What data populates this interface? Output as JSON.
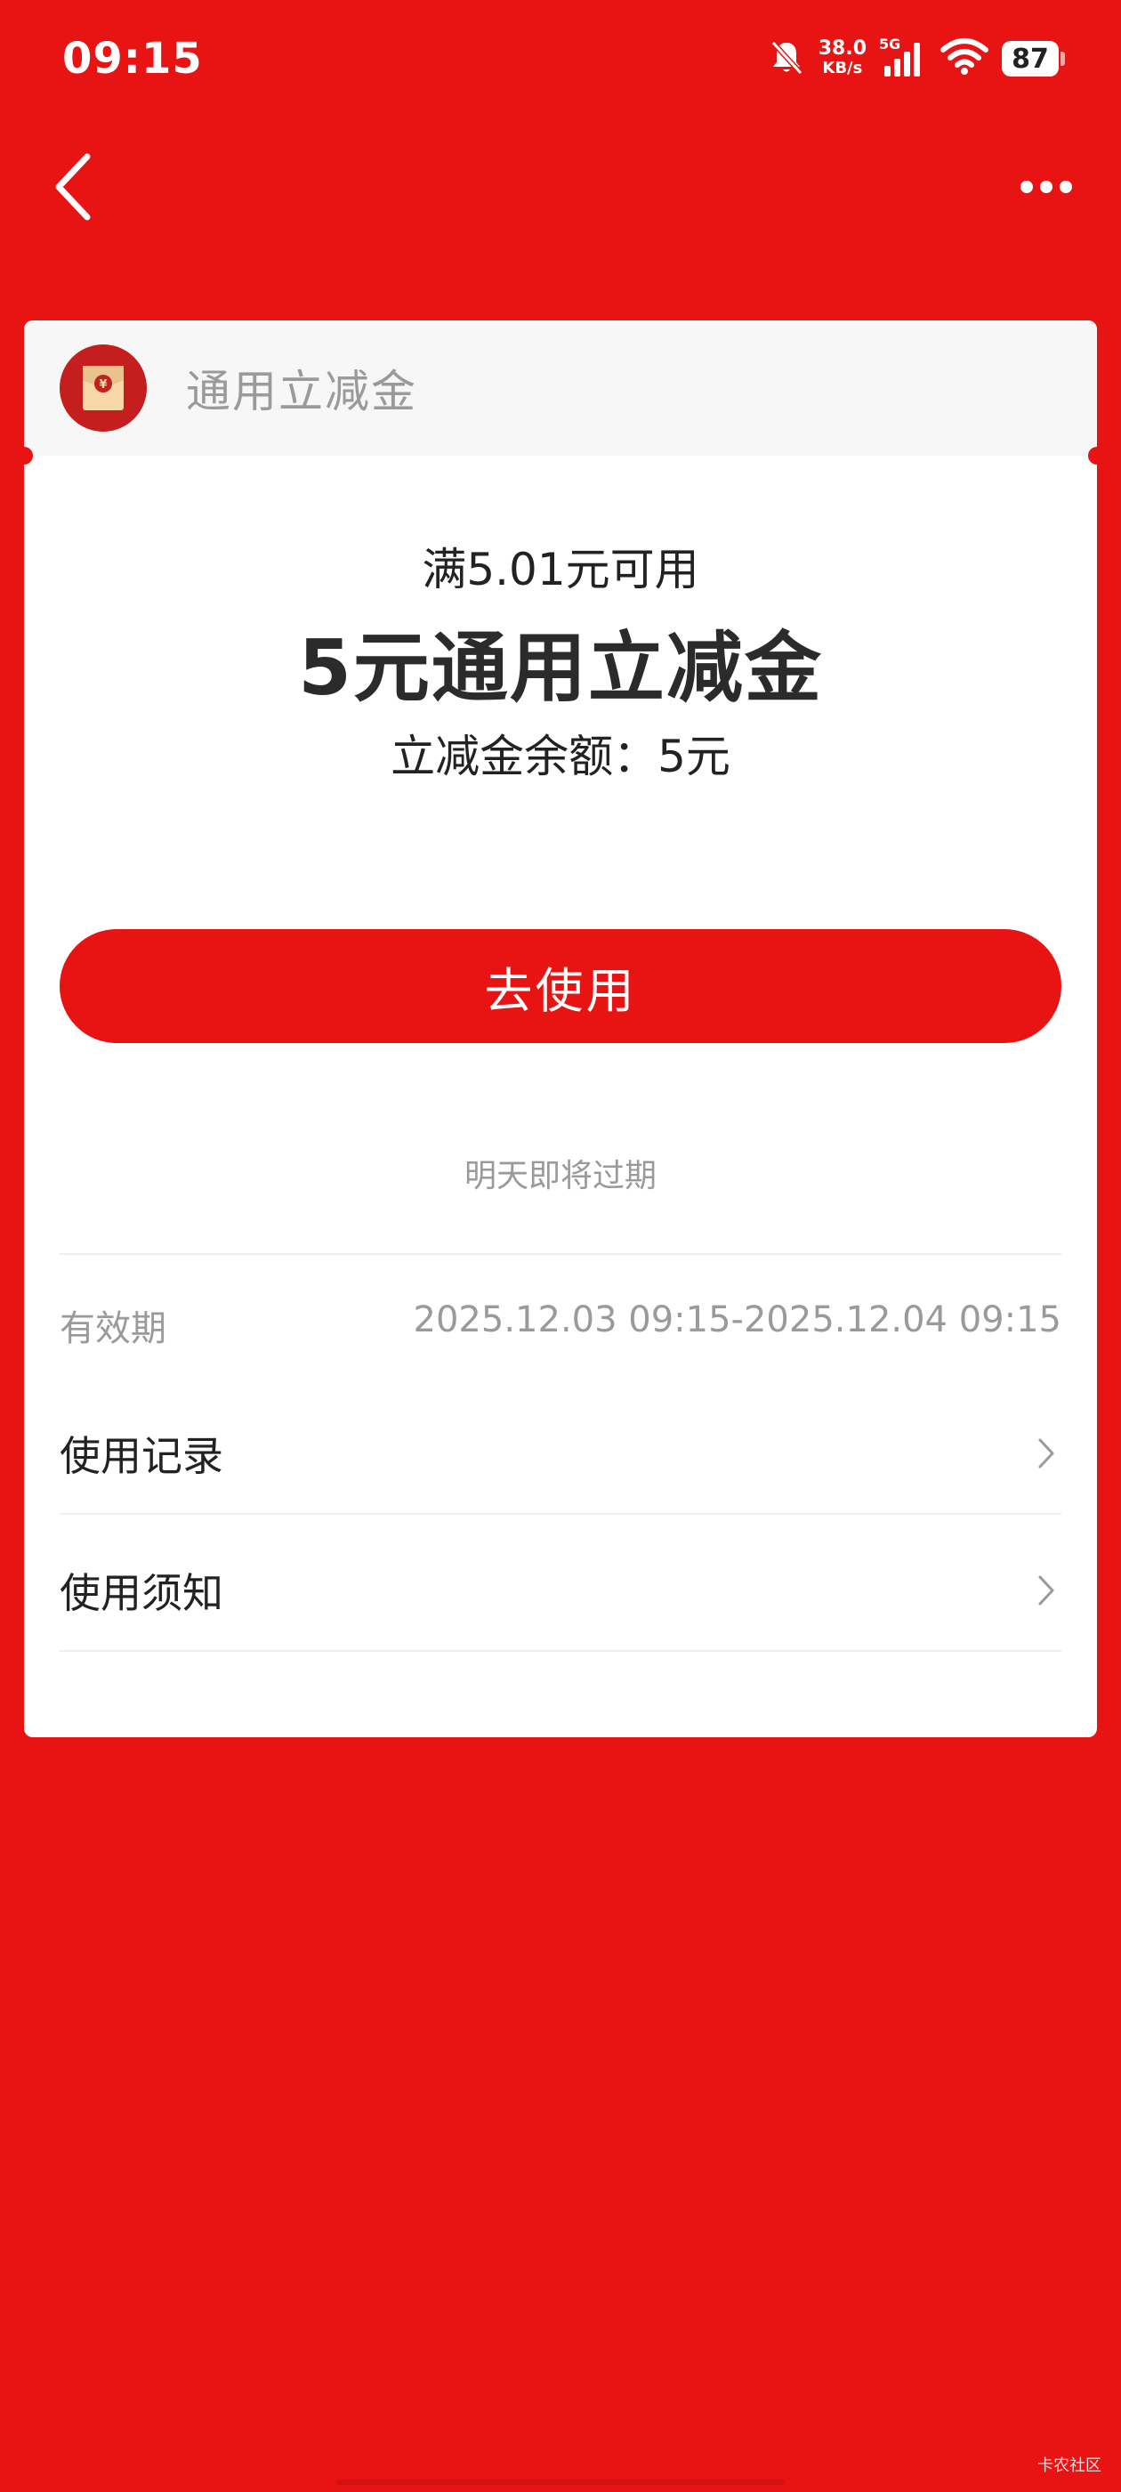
{
  "status_bar": {
    "time": "09:15",
    "net_speed_value": "38.0",
    "net_speed_unit": "KB/s",
    "network_type": "5G",
    "battery": "87"
  },
  "header": {
    "title": "通用立减金"
  },
  "coupon": {
    "condition": "满5.01元可用",
    "title": "5元通用立减金",
    "balance": "立减金余额：5元",
    "use_button": "去使用",
    "expire_note": "明天即将过期"
  },
  "validity": {
    "label": "有效期",
    "value": "2025.12.03 09:15-2025.12.04 09:15"
  },
  "links": [
    {
      "label": "使用记录"
    },
    {
      "label": "使用须知"
    }
  ],
  "watermark": "卡农社区",
  "colors": {
    "background": "#e81313",
    "card": "#ffffff",
    "primary_button": "#e81313",
    "muted_text": "#9a9a9a"
  }
}
